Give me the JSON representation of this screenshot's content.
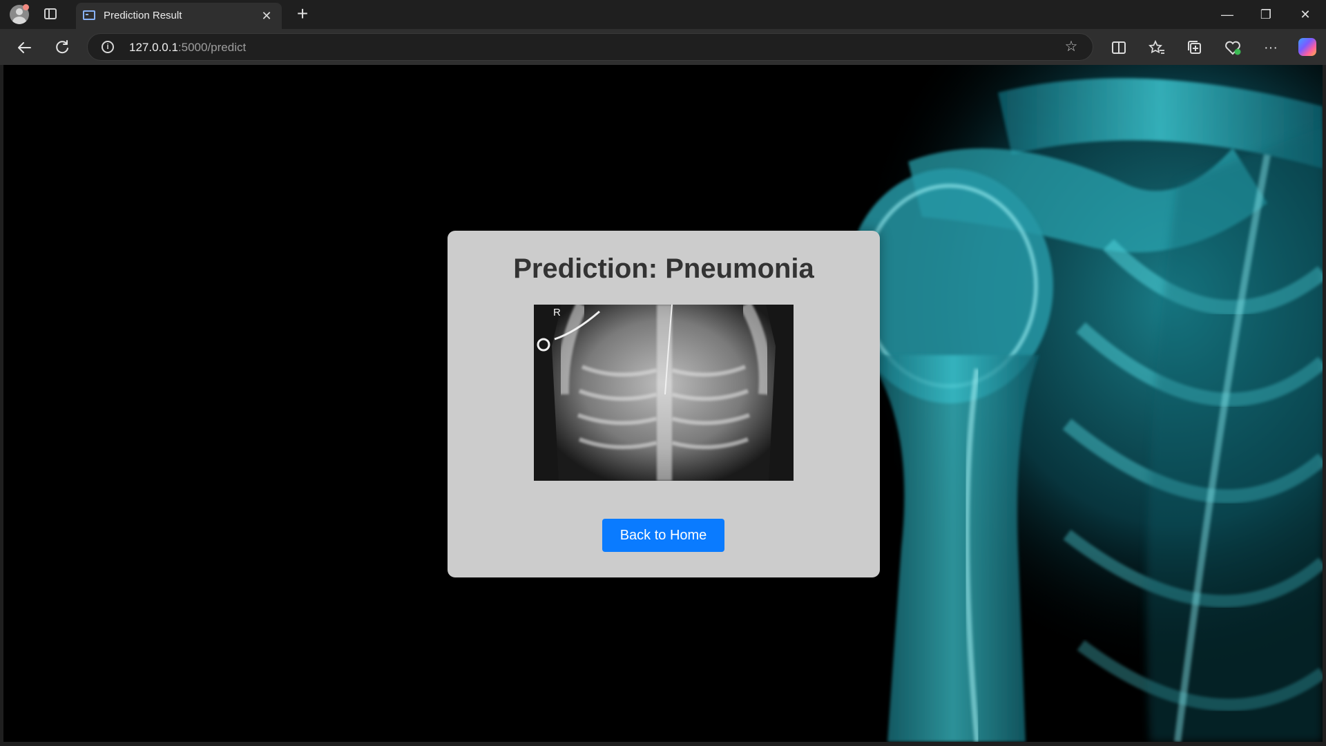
{
  "browser": {
    "tab_title": "Prediction Result",
    "tab_close": "✕",
    "new_tab": "+",
    "url_host": "127.0.0.1",
    "url_rest": ":5000/predict",
    "window_controls": {
      "minimize": "—",
      "restore": "❐",
      "close": "✕"
    },
    "icons": [
      "profile-icon",
      "tab-actions-icon",
      "back-arrow-icon",
      "refresh-icon",
      "site-info-icon",
      "favorite-star-icon",
      "split-screen-icon",
      "favorites-icon",
      "collections-icon",
      "browser-essentials-icon",
      "more-icon",
      "copilot-icon"
    ]
  },
  "page": {
    "title": "Prediction: Pneumonia",
    "image_marker": "R",
    "back_button": "Back to Home",
    "accent_color": "#0a7bff",
    "card_color": "#cccccc"
  }
}
